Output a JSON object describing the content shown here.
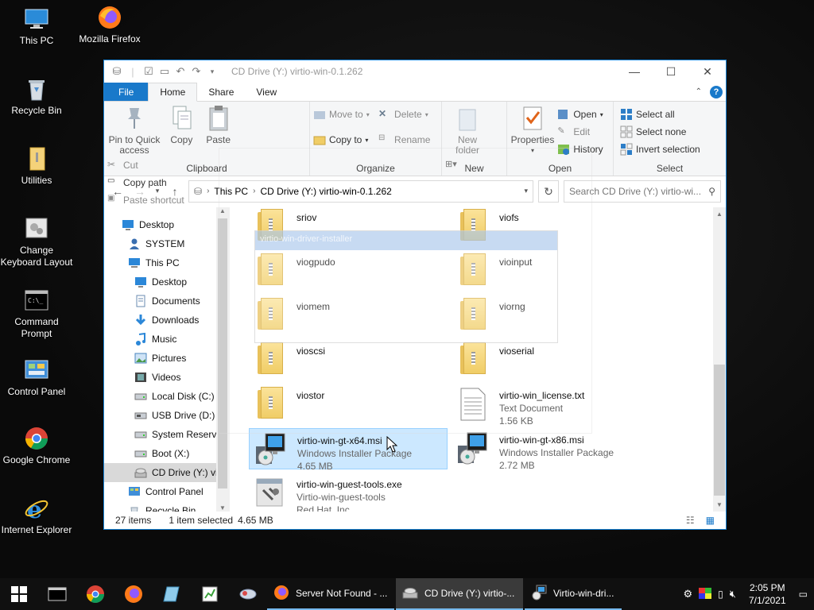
{
  "desktop": {
    "icons": [
      {
        "label": "This PC",
        "icon": "computer-icon"
      },
      {
        "label": "Mozilla Firefox",
        "icon": "firefox-icon"
      },
      {
        "label": "Recycle Bin",
        "icon": "recycle-bin-icon"
      },
      {
        "label": "Utilities",
        "icon": "folder-icon"
      },
      {
        "label": "Change Keyboard Layout",
        "icon": "keyboard-settings-icon"
      },
      {
        "label": "Command Prompt",
        "icon": "command-prompt-icon"
      },
      {
        "label": "Control Panel",
        "icon": "control-panel-icon"
      },
      {
        "label": "Google Chrome",
        "icon": "chrome-icon"
      },
      {
        "label": "Internet Explorer",
        "icon": "internet-explorer-icon"
      }
    ]
  },
  "window": {
    "title": "CD Drive (Y:) virtio-win-0.1.262",
    "tabs": {
      "file": "File",
      "home": "Home",
      "share": "Share",
      "view": "View"
    },
    "ribbon": {
      "clipboard": {
        "label": "Clipboard",
        "pin": "Pin to Quick access",
        "copy": "Copy",
        "paste": "Paste",
        "cut": "Cut",
        "copy_path": "Copy path",
        "paste_shortcut": "Paste shortcut"
      },
      "organize": {
        "label": "Organize",
        "move_to": "Move to",
        "copy_to": "Copy to",
        "delete": "Delete",
        "rename": "Rename"
      },
      "new": {
        "label": "New",
        "new_folder": "New folder"
      },
      "open": {
        "label": "Open",
        "properties": "Properties",
        "open": "Open",
        "edit": "Edit",
        "history": "History"
      },
      "select": {
        "label": "Select",
        "select_all": "Select all",
        "select_none": "Select none",
        "invert": "Invert selection"
      }
    },
    "address": {
      "crumb1": "This PC",
      "crumb2": "CD Drive (Y:) virtio-win-0.1.262",
      "search_placeholder": "Search CD Drive (Y:) virtio-wi..."
    },
    "nav": [
      {
        "label": "Desktop",
        "indent": 0,
        "icon": "desktop-icon"
      },
      {
        "label": "SYSTEM",
        "indent": 1,
        "icon": "user-icon"
      },
      {
        "label": "This PC",
        "indent": 1,
        "icon": "computer-icon"
      },
      {
        "label": "Desktop",
        "indent": 2,
        "icon": "desktop-icon"
      },
      {
        "label": "Documents",
        "indent": 2,
        "icon": "documents-icon"
      },
      {
        "label": "Downloads",
        "indent": 2,
        "icon": "downloads-icon"
      },
      {
        "label": "Music",
        "indent": 2,
        "icon": "music-icon"
      },
      {
        "label": "Pictures",
        "indent": 2,
        "icon": "pictures-icon"
      },
      {
        "label": "Videos",
        "indent": 2,
        "icon": "videos-icon"
      },
      {
        "label": "Local Disk (C:)",
        "indent": 2,
        "icon": "disk-icon"
      },
      {
        "label": "USB Drive (D:)",
        "indent": 2,
        "icon": "usb-drive-icon"
      },
      {
        "label": "System Reserve",
        "indent": 2,
        "icon": "disk-icon"
      },
      {
        "label": "Boot (X:)",
        "indent": 2,
        "icon": "disk-icon"
      },
      {
        "label": "CD Drive (Y:) vi",
        "indent": 2,
        "icon": "cd-drive-icon",
        "selected": true
      },
      {
        "label": "Control Panel",
        "indent": 1,
        "icon": "control-panel-icon"
      },
      {
        "label": "Recycle Bin",
        "indent": 1,
        "icon": "recycle-bin-icon"
      }
    ],
    "files": [
      {
        "name": "sriov",
        "type": "folder"
      },
      {
        "name": "viofs",
        "type": "folder"
      },
      {
        "name": "viogpudo",
        "type": "folder"
      },
      {
        "name": "vioinput",
        "type": "folder"
      },
      {
        "name": "viomem",
        "type": "folder"
      },
      {
        "name": "viorng",
        "type": "folder"
      },
      {
        "name": "vioscsi",
        "type": "folder"
      },
      {
        "name": "vioserial",
        "type": "folder"
      },
      {
        "name": "viostor",
        "type": "folder"
      },
      {
        "name": "virtio-win_license.txt",
        "type": "text",
        "sub1": "Text Document",
        "sub2": "1.56 KB"
      },
      {
        "name": "virtio-win-gt-x64.msi",
        "type": "msi",
        "sub1": "Windows Installer Package",
        "sub2": "4.65 MB",
        "selected": true
      },
      {
        "name": "virtio-win-gt-x86.msi",
        "type": "msi",
        "sub1": "Windows Installer Package",
        "sub2": "2.72 MB"
      },
      {
        "name": "virtio-win-guest-tools.exe",
        "type": "exe",
        "sub1": "Virtio-win-guest-tools",
        "sub2": "Red Hat, Inc."
      }
    ],
    "drag_ghost_title": "virtio-win-driver-installer",
    "status": {
      "count": "27 items",
      "selected": "1 item selected",
      "size": "4.65 MB"
    }
  },
  "taskbar": {
    "apps": [
      {
        "label": "Server Not Found - ...",
        "icon": "firefox-icon"
      },
      {
        "label": "CD Drive (Y:) virtio-...",
        "icon": "cd-drive-icon",
        "active": true
      },
      {
        "label": "Virtio-win-dri...",
        "icon": "installer-icon"
      }
    ],
    "time": "2:05 PM",
    "date": "7/1/2021"
  },
  "colors": {
    "accent": "#1979ca",
    "selection": "#cce8ff",
    "selection_border": "#99d1ff"
  }
}
